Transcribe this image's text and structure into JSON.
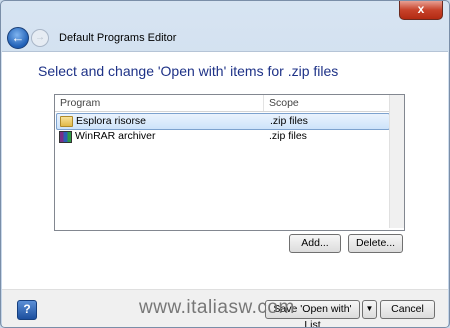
{
  "window": {
    "title": "Default Programs Editor",
    "close_label": "x",
    "back_glyph": "←",
    "forward_glyph": "→"
  },
  "main": {
    "heading": "Select and change 'Open with' items for .zip files",
    "list": {
      "columns": [
        "Program",
        "Scope"
      ],
      "rows": [
        {
          "program": "Esplora risorse",
          "scope": ".zip files",
          "icon": "folder-icon",
          "selected": true
        },
        {
          "program": "WinRAR archiver",
          "scope": ".zip files",
          "icon": "winrar-icon",
          "selected": false
        }
      ]
    },
    "buttons": {
      "add": "Add...",
      "delete": "Delete..."
    }
  },
  "footer": {
    "help_label": "?",
    "save_label": "Save 'Open with' List",
    "split_arrow": "▼",
    "cancel_label": "Cancel"
  },
  "watermark": "www.italiasw.com"
}
